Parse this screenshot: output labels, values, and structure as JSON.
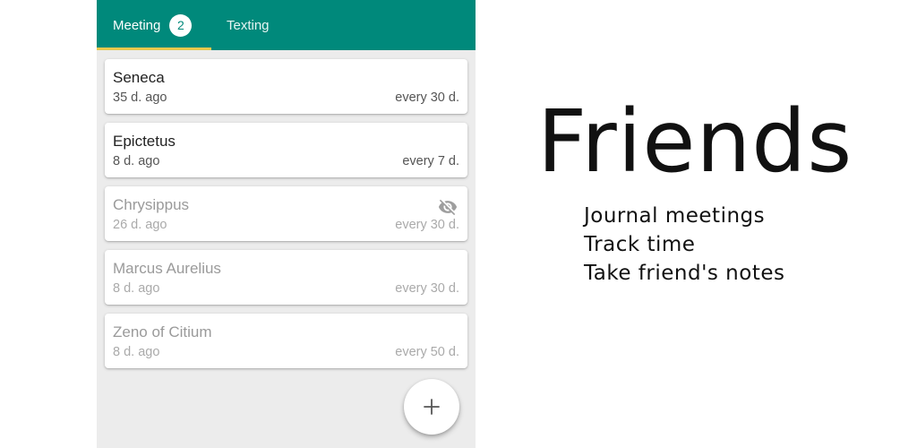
{
  "tabs": [
    {
      "label": "Meeting",
      "badge": "2",
      "active": true
    },
    {
      "label": "Texting",
      "active": false
    }
  ],
  "accent_colors": {
    "app_bar": "#00897b",
    "tab_indicator": "#e6c84c"
  },
  "friends": [
    {
      "name": "Seneca",
      "last_seen": "35 d. ago",
      "frequency": "every 30 d.",
      "muted": false,
      "hidden_icon": false
    },
    {
      "name": "Epictetus",
      "last_seen": "8 d. ago",
      "frequency": "every 7 d.",
      "muted": false,
      "hidden_icon": false
    },
    {
      "name": "Chrysippus",
      "last_seen": "26 d. ago",
      "frequency": "every 30 d.",
      "muted": true,
      "hidden_icon": true
    },
    {
      "name": "Marcus Aurelius",
      "last_seen": "8 d. ago",
      "frequency": "every 30 d.",
      "muted": true,
      "hidden_icon": false
    },
    {
      "name": "Zeno of Citium",
      "last_seen": "8 d. ago",
      "frequency": "every 50 d.",
      "muted": true,
      "hidden_icon": false
    }
  ],
  "icons": {
    "hidden": "eye-off-icon",
    "fab": "plus-icon"
  },
  "promo": {
    "title": "Friends",
    "lines": [
      "Journal meetings",
      "Track time",
      "Take friend's notes"
    ]
  }
}
